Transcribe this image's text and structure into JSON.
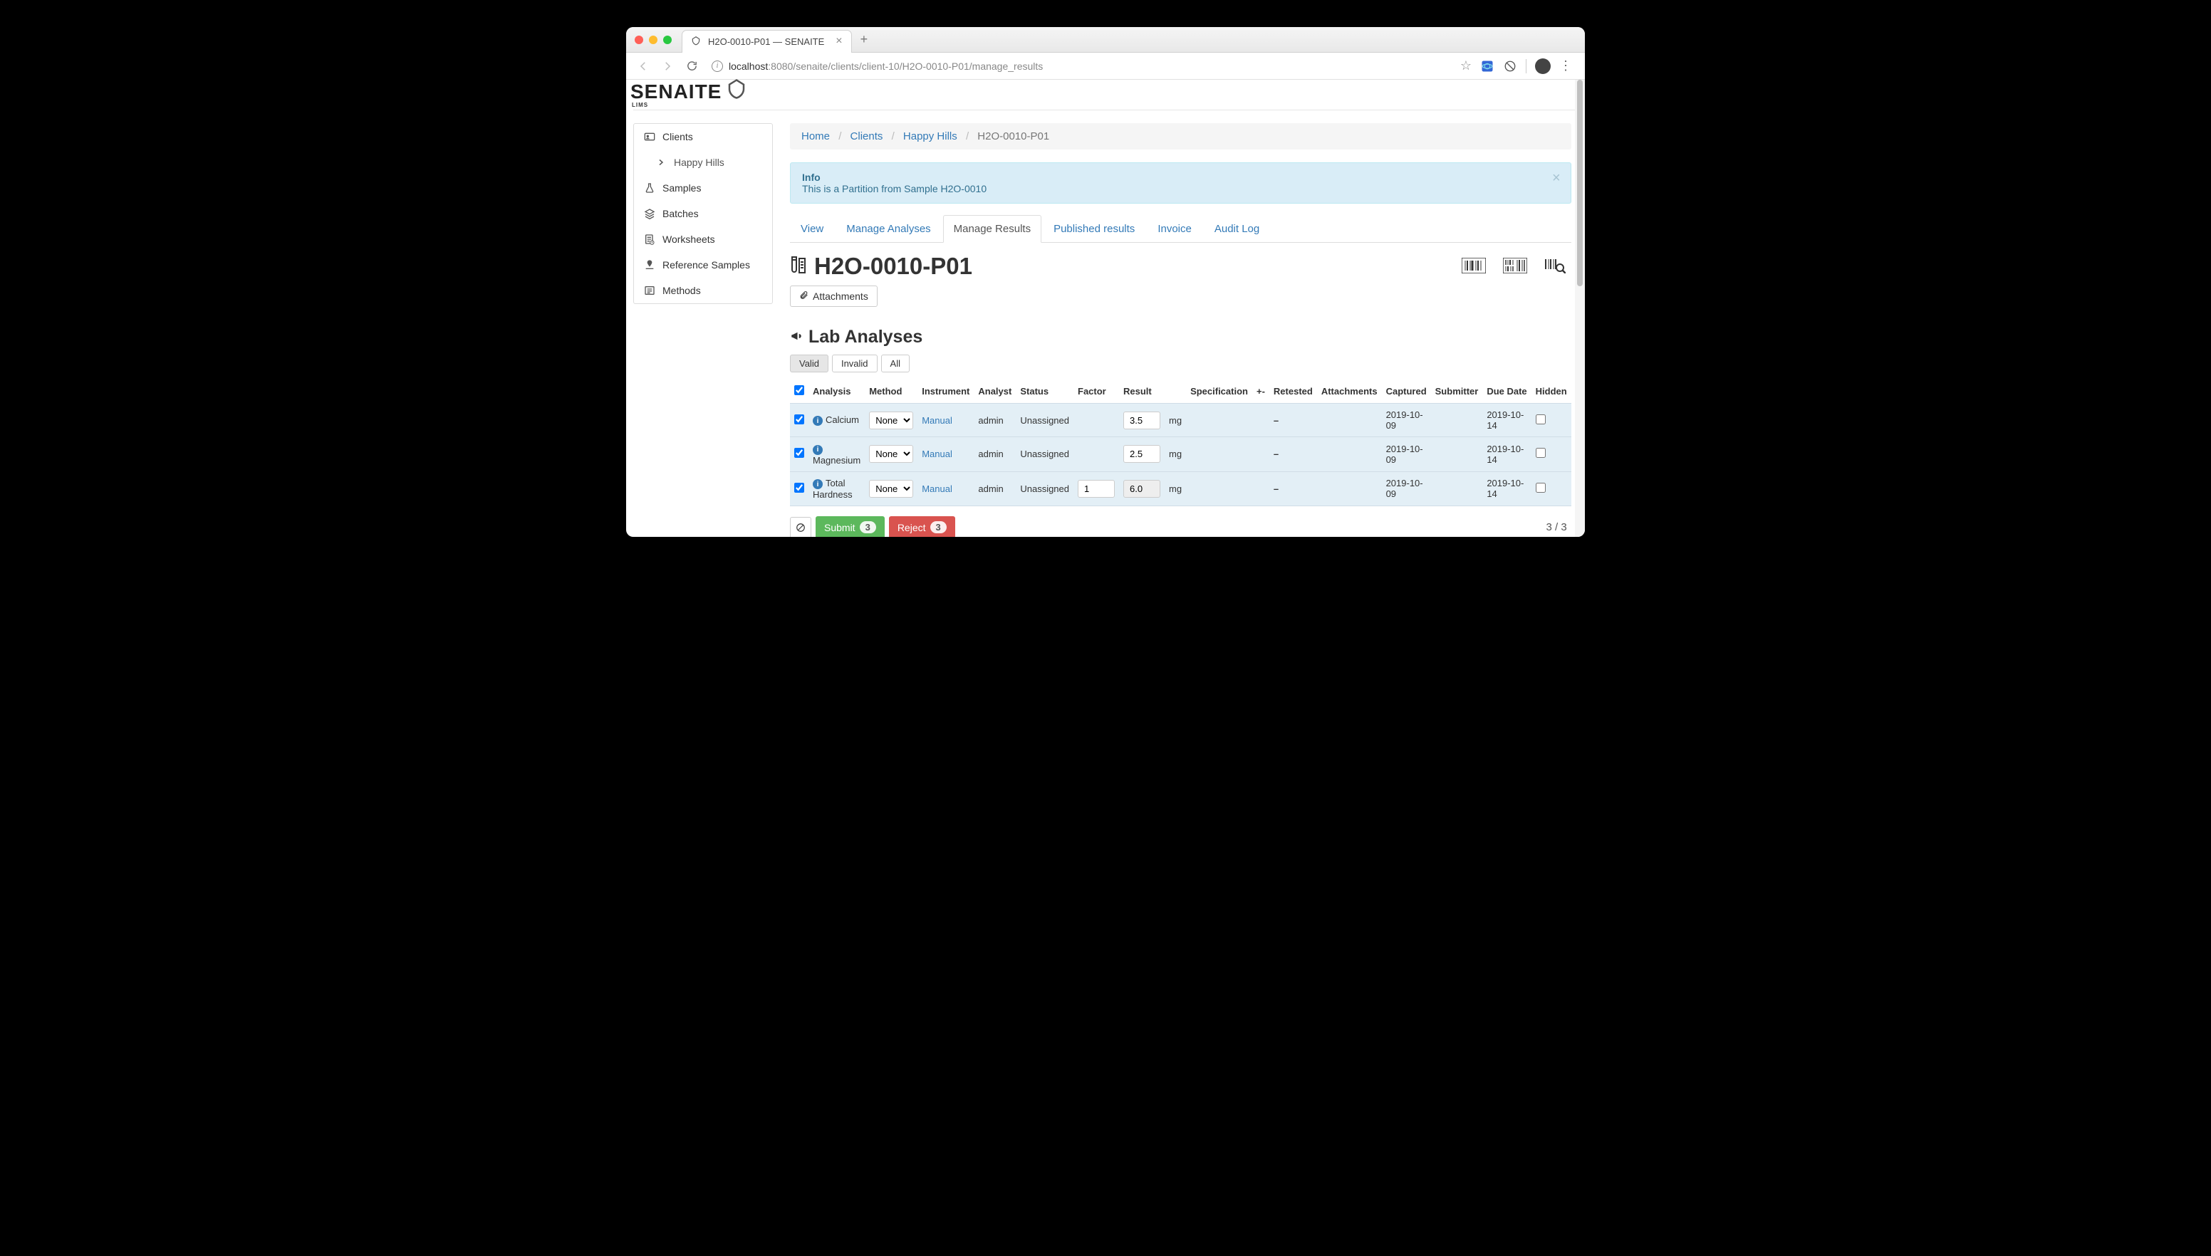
{
  "browser": {
    "tab_title": "H2O-0010-P01 — SENAITE",
    "url_host": "localhost",
    "url_path": ":8080/senaite/clients/client-10/H2O-0010-P01/manage_results"
  },
  "logo": {
    "text": "SENAITE",
    "sub": "LIMS"
  },
  "sidebar": {
    "clients": "Clients",
    "client_name": "Happy Hills",
    "samples": "Samples",
    "batches": "Batches",
    "worksheets": "Worksheets",
    "reference": "Reference Samples",
    "methods": "Methods"
  },
  "breadcrumb": {
    "home": "Home",
    "clients": "Clients",
    "client": "Happy Hills",
    "current": "H2O-0010-P01"
  },
  "alert": {
    "title": "Info",
    "body": "This is a Partition from Sample H2O-0010"
  },
  "tabs": {
    "view": "View",
    "manage_analyses": "Manage Analyses",
    "manage_results": "Manage Results",
    "published": "Published results",
    "invoice": "Invoice",
    "audit": "Audit Log"
  },
  "page": {
    "title": "H2O-0010-P01",
    "attachments": "Attachments"
  },
  "section": {
    "title": "Lab Analyses"
  },
  "filters": {
    "valid": "Valid",
    "invalid": "Invalid",
    "all": "All"
  },
  "columns": {
    "analysis": "Analysis",
    "method": "Method",
    "instrument": "Instrument",
    "analyst": "Analyst",
    "status": "Status",
    "factor": "Factor",
    "result": "Result",
    "specification": "Specification",
    "pm": "+-",
    "retested": "Retested",
    "attachments": "Attachments",
    "captured": "Captured",
    "submitter": "Submitter",
    "due": "Due Date",
    "hidden": "Hidden"
  },
  "method_option": "None",
  "rows": [
    {
      "analysis": "Calcium",
      "instrument": "Manual",
      "analyst": "admin",
      "status": "Unassigned",
      "factor": "",
      "result": "3.5",
      "result_ro": false,
      "unit": "mg",
      "retested": "–",
      "captured": "2019-10-09",
      "due": "2019-10-14"
    },
    {
      "analysis": "Magnesium",
      "instrument": "Manual",
      "analyst": "admin",
      "status": "Unassigned",
      "factor": "",
      "result": "2.5",
      "result_ro": false,
      "unit": "mg",
      "retested": "–",
      "captured": "2019-10-09",
      "due": "2019-10-14"
    },
    {
      "analysis": "Total Hardness",
      "instrument": "Manual",
      "analyst": "admin",
      "status": "Unassigned",
      "factor": "1",
      "result": "6.0",
      "result_ro": true,
      "unit": "mg",
      "retested": "–",
      "captured": "2019-10-09",
      "due": "2019-10-14"
    }
  ],
  "actions": {
    "submit": "Submit",
    "submit_count": "3",
    "reject": "Reject",
    "reject_count": "3"
  },
  "counter": "3 / 3"
}
